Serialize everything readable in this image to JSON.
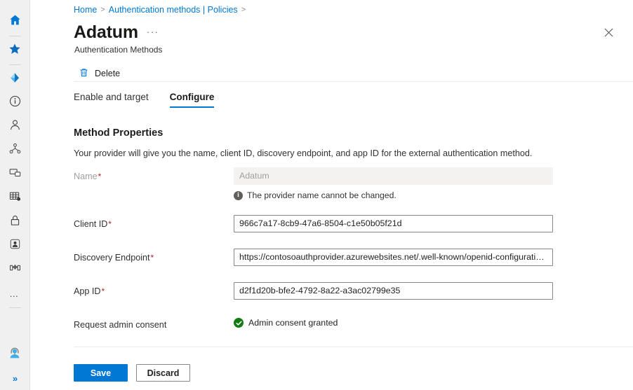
{
  "sidebar": {
    "items": [
      {
        "name": "home-icon",
        "label": "Home"
      },
      {
        "name": "favorites-star-icon",
        "label": "Favorites"
      },
      {
        "name": "azure-active-directory-icon",
        "label": "Azure Active Directory"
      },
      {
        "name": "info-circle-icon",
        "label": "Information"
      },
      {
        "name": "user-icon",
        "label": "Users"
      },
      {
        "name": "groups-icon",
        "label": "Groups"
      },
      {
        "name": "devices-icon",
        "label": "Devices"
      },
      {
        "name": "enterprise-apps-grid-icon",
        "label": "Enterprise applications"
      },
      {
        "name": "lock-icon",
        "label": "Security"
      },
      {
        "name": "identity-governance-icon",
        "label": "Identity Governance"
      },
      {
        "name": "app-registrations-icon",
        "label": "App registrations"
      }
    ],
    "more_label": "…",
    "support_icon_label": "Help and support",
    "expand_label": "»"
  },
  "breadcrumb": {
    "items": [
      "Home",
      "Authentication methods | Policies"
    ],
    "separator": ">"
  },
  "header": {
    "title": "Adatum",
    "ellipsis": "···",
    "subtitle": "Authentication Methods",
    "close_label": "✕"
  },
  "toolbar": {
    "delete_label": "Delete"
  },
  "tabs": [
    {
      "label": "Enable and target",
      "active": false
    },
    {
      "label": "Configure",
      "active": true
    }
  ],
  "section": {
    "title": "Method Properties",
    "description": "Your provider will give you the name, client ID, discovery endpoint, and app ID for the external authentication method."
  },
  "form": {
    "name": {
      "label": "Name",
      "required": "*",
      "value": "Adatum",
      "placeholder": "Adatum",
      "disabled": true,
      "hint": "The provider name cannot be changed."
    },
    "client_id": {
      "label": "Client ID",
      "required": "*",
      "value": "966c7a17-8cb9-47a6-8504-c1e50b05f21d",
      "placeholder": "Client ID"
    },
    "discovery_endpoint": {
      "label": "Discovery Endpoint",
      "required": "*",
      "value": "https://contosoauthprovider.azurewebsites.net/.well-known/openid-configurati…",
      "placeholder": "Discovery Endpoint"
    },
    "app_id": {
      "label": "App ID",
      "required": "*",
      "value": "d2f1d20b-bfe2-4792-8a22-a3ac02799e35",
      "placeholder": "App ID"
    },
    "admin_consent": {
      "label": "Request admin consent",
      "status_text": "Admin consent granted",
      "status_color": "#107c10"
    }
  },
  "actions": {
    "save_label": "Save",
    "discard_label": "Discard"
  },
  "colors": {
    "accent": "#0078d4",
    "success": "#107c10",
    "required": "#a4262c",
    "rail_bg": "#f0f0f0"
  }
}
